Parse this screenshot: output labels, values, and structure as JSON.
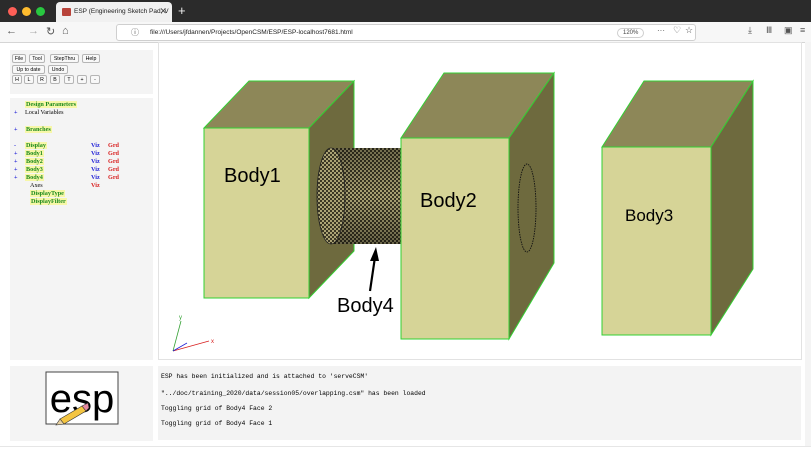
{
  "browser": {
    "tab_title": "ESP (Engineering Sketch Pad, V",
    "tab_close": "✕",
    "new_tab": "+",
    "url": "file:///Users/jfdannen/Projects/OpenCSM/ESP/ESP-localhost7681.html",
    "zoom": "120%",
    "page_menu": "···",
    "back": "←",
    "forward": "→",
    "reload": "↻",
    "home": "⌂",
    "info_icon": "ⓘ",
    "pocket_icon": "♡",
    "star_icon": "☆",
    "download_icon": "⤓",
    "library_icon": "Ⅲ",
    "sidebar_icon": "▣",
    "menu_icon": "≡",
    "colors": {
      "close": "#fe5f57",
      "minimize": "#febc2e",
      "maximize": "#28c840"
    }
  },
  "toolbar": {
    "file": "File",
    "tool": "Tool",
    "stepthru": "StepThru",
    "help": "Help",
    "uptodate": "Up to date",
    "undo": "Undo",
    "views": [
      "H",
      "L",
      "R",
      "B",
      "T",
      "+",
      "-"
    ]
  },
  "tree": {
    "design_parameters": "Design Parameters",
    "local_variables": "Local Variables",
    "branches": "Branches",
    "display": "Display",
    "viz": "Viz",
    "grd": "Grd",
    "bodies": [
      "Body1",
      "Body2",
      "Body3",
      "Body4"
    ],
    "axes": "Axes",
    "display_type": "DisplayType",
    "display_filter": "DisplayFilter",
    "plus": "+",
    "minus": "-"
  },
  "viewer": {
    "labels": {
      "body1": "Body1",
      "body2": "Body2",
      "body3": "Body3",
      "body4": "Body4"
    },
    "axes": {
      "x": "x",
      "y": "y"
    },
    "colors": {
      "face": "#d6d497",
      "side": "#6e6a3e",
      "top": "#8d8758",
      "edge": "#33d033"
    }
  },
  "logo": {
    "text": "esp"
  },
  "messages": [
    "ESP has been initialized and is attached to 'serveCSM'",
    "\"../doc/training_2020/data/session05/overlapping.csm\" has been loaded",
    "Toggling grid of Body4 Face 2",
    "Toggling grid of Body4 Face 1"
  ]
}
